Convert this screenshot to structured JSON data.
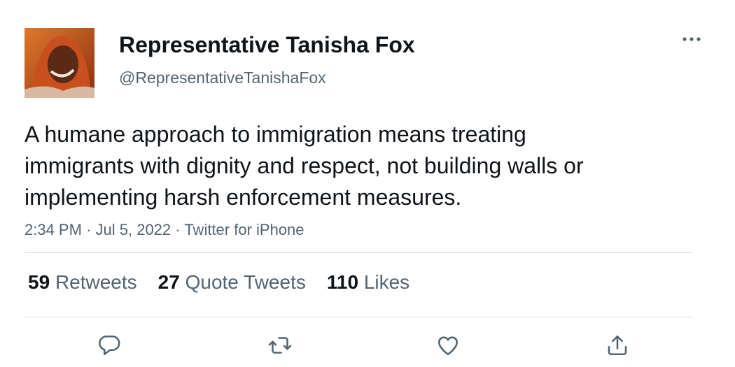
{
  "author": {
    "display_name": "Representative Tanisha Fox",
    "handle": "@RepresentativeTanishaFox",
    "avatar_icon": "profile-photo"
  },
  "tweet": {
    "text": "A humane approach to immigration means treating immigrants with dignity and respect, not building walls or implementing harsh enforcement measures.",
    "time": "2:34 PM",
    "date": "Jul 5, 2022",
    "source": "Twitter for iPhone"
  },
  "stats": {
    "retweets_count": "59",
    "retweets_label": "Retweets",
    "quotes_count": "27",
    "quotes_label": "Quote Tweets",
    "likes_count": "110",
    "likes_label": "Likes"
  },
  "actions": [
    "reply-icon",
    "retweet-icon",
    "like-icon",
    "share-icon"
  ],
  "colors": {
    "text": "#0f1419",
    "secondary": "#536471",
    "divider": "#dadfe3"
  }
}
